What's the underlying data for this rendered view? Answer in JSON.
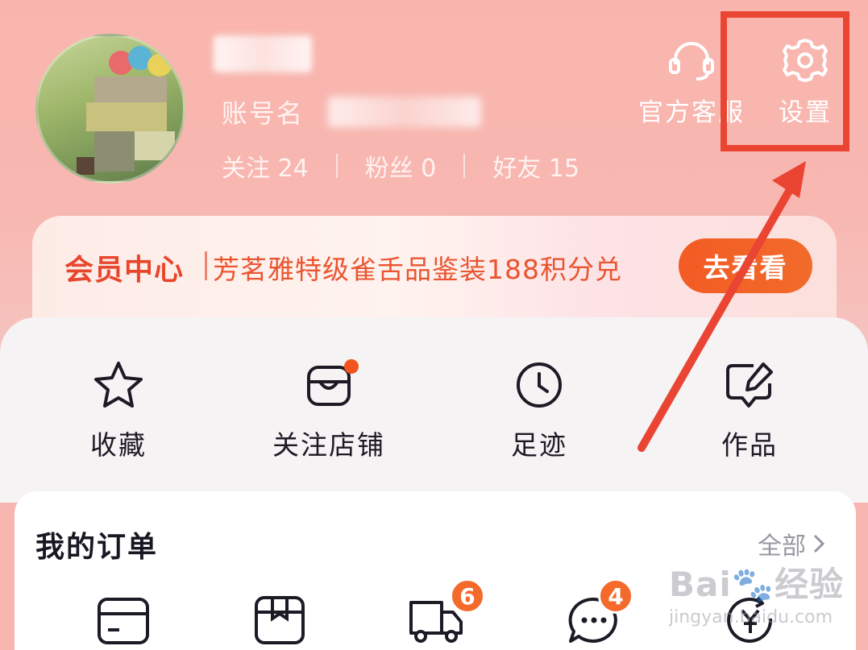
{
  "header": {
    "account_label": "账号名",
    "stats": [
      {
        "label": "关注",
        "value": "24"
      },
      {
        "label": "粉丝",
        "value": "0"
      },
      {
        "label": "好友",
        "value": "15"
      }
    ],
    "service_label": "官方客服",
    "settings_label": "设置"
  },
  "member": {
    "title": "会员中心",
    "promo": "芳茗雅特级雀舌品鉴装188积分兑",
    "button": "去看看"
  },
  "quick_actions": [
    {
      "label": "收藏",
      "icon": "star-icon"
    },
    {
      "label": "关注店铺",
      "icon": "store-icon"
    },
    {
      "label": "足迹",
      "icon": "clock-icon"
    },
    {
      "label": "作品",
      "icon": "edit-icon"
    }
  ],
  "orders": {
    "title": "我的订单",
    "all_label": "全部",
    "items": [
      {
        "icon": "card-icon"
      },
      {
        "icon": "package-icon"
      },
      {
        "icon": "truck-icon",
        "badge": "6"
      },
      {
        "icon": "chat-icon",
        "badge": "4"
      },
      {
        "icon": "refund-icon"
      }
    ]
  },
  "watermark": {
    "brand": "Bai",
    "brand2": "经验",
    "sub": "jingyan.baidu.com"
  },
  "colors": {
    "accent": "#f2541f",
    "highlight": "#ea4433",
    "header_bg": "#f8b7b1"
  }
}
